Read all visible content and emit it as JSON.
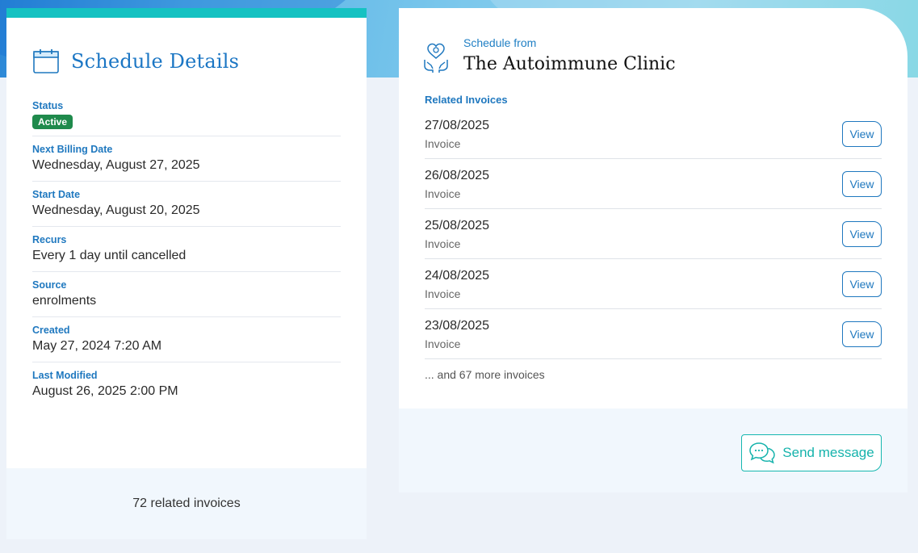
{
  "schedule": {
    "title": "Schedule Details",
    "fields": [
      {
        "label": "Status",
        "badge": "Active"
      },
      {
        "label": "Next Billing Date",
        "value": "Wednesday, August 27, 2025"
      },
      {
        "label": "Start Date",
        "value": "Wednesday, August 20, 2025"
      },
      {
        "label": "Recurs",
        "value": "Every 1 day until cancelled"
      },
      {
        "label": "Source",
        "value": "enrolments"
      },
      {
        "label": "Created",
        "value": "May 27, 2024 7:20 AM"
      },
      {
        "label": "Last Modified",
        "value": "August 26, 2025 2:00 PM"
      }
    ],
    "footer": "72 related invoices"
  },
  "clinic": {
    "from_label": "Schedule from",
    "name": "The Autoimmune Clinic"
  },
  "invoices": {
    "heading": "Related Invoices",
    "items": [
      {
        "date": "27/08/2025",
        "type": "Invoice",
        "action": "View"
      },
      {
        "date": "26/08/2025",
        "type": "Invoice",
        "action": "View"
      },
      {
        "date": "25/08/2025",
        "type": "Invoice",
        "action": "View"
      },
      {
        "date": "24/08/2025",
        "type": "Invoice",
        "action": "View"
      },
      {
        "date": "23/08/2025",
        "type": "Invoice",
        "action": "View"
      }
    ],
    "more": "... and 67 more invoices"
  },
  "send_message_label": "Send message",
  "colors": {
    "accent": "#1f78bf",
    "teal": "#15c2c2",
    "status_active": "#1f8a4c"
  }
}
